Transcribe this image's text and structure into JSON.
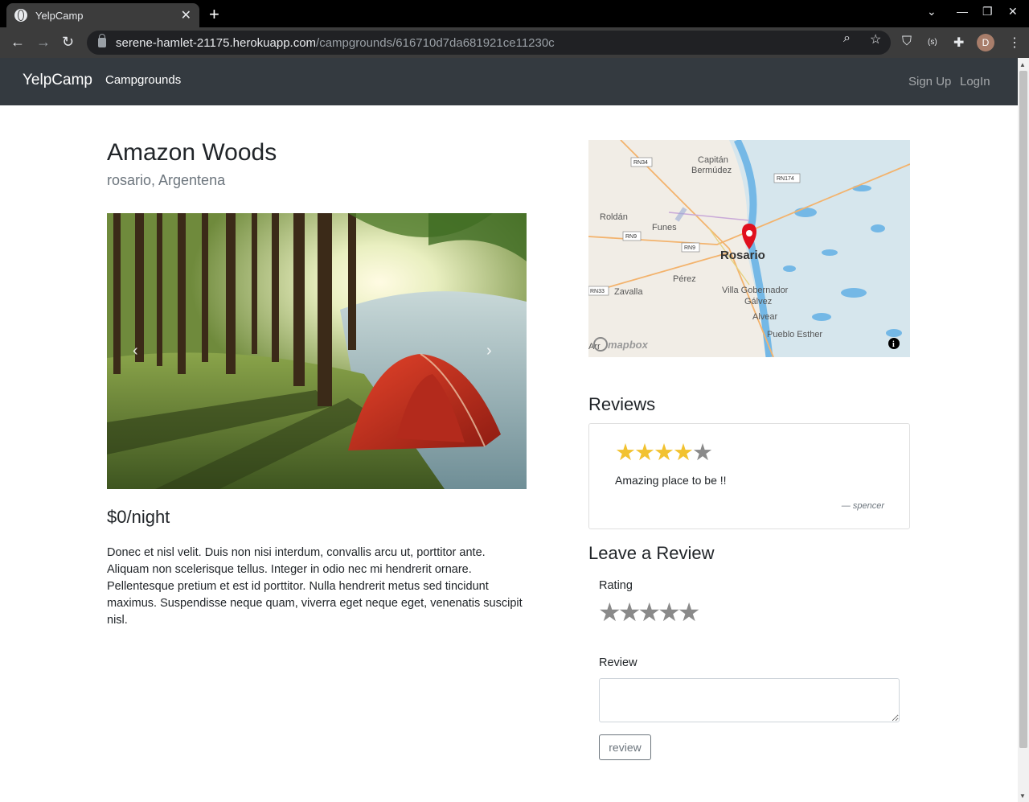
{
  "browser": {
    "tab_title": "YelpCamp",
    "url_host": "serene-hamlet-21175.herokuapp.com",
    "url_path": "/campgrounds/616710d7da681921ce11230c",
    "avatar_letter": "D"
  },
  "navbar": {
    "brand": "YelpCamp",
    "campgrounds": "Campgrounds",
    "signup": "Sign Up",
    "login": "LogIn"
  },
  "campground": {
    "title": "Amazon Woods",
    "location": "rosario, Argentena",
    "price": "$0/night",
    "description": "Donec et nisl velit. Duis non nisi interdum, convallis arcu ut, porttitor ante. Aliquam non scelerisque tellus. Integer in odio nec mi hendrerit ornare. Pellentesque pretium et est id porttitor. Nulla hendrerit metus sed tincidunt maximus. Suspendisse neque quam, viverra eget neque eget, venenatis suscipit nisl."
  },
  "map": {
    "city": "Rosario",
    "labels": {
      "capitan": "Capitán",
      "bermudez": "Bermúdez",
      "roldan": "Roldán",
      "funes": "Funes",
      "perez": "Pérez",
      "zavalla": "Zavalla",
      "villa_gob": "Villa Gobernador",
      "galvez": "Gálvez",
      "alvear": "Alvear",
      "pueblo": "Pueblo Esther",
      "arr": "Arr",
      "rn34": "RN34",
      "rn174": "RN174",
      "rn9a": "RN9",
      "rn9b": "RN9",
      "rn33": "RN33",
      "mapbox": "mapbox"
    }
  },
  "reviews": {
    "heading": "Reviews",
    "items": [
      {
        "rating": 4,
        "text": "Amazing place to be !!",
        "author": "— spencer"
      }
    ]
  },
  "leave_review": {
    "heading": "Leave a Review",
    "rating_label": "Rating",
    "review_label": "Review",
    "textarea_value": "",
    "button": "review"
  },
  "colors": {
    "star_on": "#f2c230",
    "star_off": "#8a8a8a",
    "navbar_bg": "#343a40"
  }
}
